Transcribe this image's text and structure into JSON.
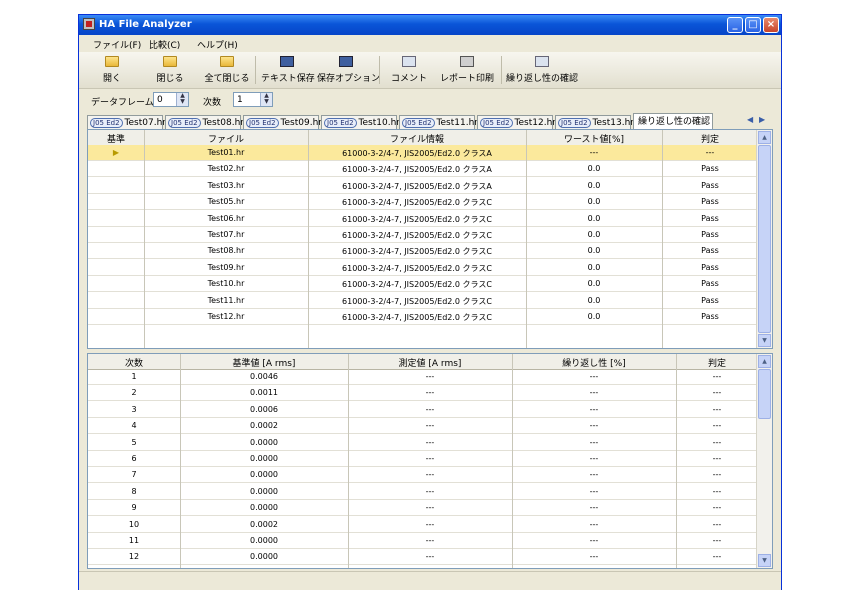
{
  "window": {
    "title": "HA File Analyzer"
  },
  "menu": [
    {
      "label": "ファイル(F)"
    },
    {
      "label": "比較(C)"
    },
    {
      "label": "ヘルプ(H)"
    }
  ],
  "toolbar": [
    {
      "label": "開く",
      "icon": "folder-open-icon"
    },
    {
      "label": "閉じる",
      "icon": "folder-icon"
    },
    {
      "label": "全て閉じる",
      "icon": "folder-icon"
    },
    {
      "label": "テキスト保存",
      "icon": "save-disk-icon"
    },
    {
      "label": "保存オプション",
      "icon": "save-options-icon"
    },
    {
      "label": "コメント",
      "icon": "comment-icon"
    },
    {
      "label": "レポート印刷",
      "icon": "printer-icon"
    },
    {
      "label": "繰り返し性の確認",
      "icon": "repeatability-icon"
    }
  ],
  "frame": {
    "dataframe_label": "データフレーム",
    "dataframe_value": "0",
    "order_label": "次数",
    "order_value": "1"
  },
  "tabs": [
    {
      "badge": "J05 Ed2",
      "name": "Test07.hr"
    },
    {
      "badge": "J05 Ed2",
      "name": "Test08.hr"
    },
    {
      "badge": "J05 Ed2",
      "name": "Test09.hr"
    },
    {
      "badge": "J05 Ed2",
      "name": "Test10.hr"
    },
    {
      "badge": "J05 Ed2",
      "name": "Test11.hr"
    },
    {
      "badge": "J05 Ed2",
      "name": "Test12.hr"
    },
    {
      "badge": "J05 Ed2",
      "name": "Test13.hr"
    },
    {
      "badge": "",
      "name": "繰り返し性の確認"
    }
  ],
  "file_table": {
    "columns": [
      "基準",
      "ファイル",
      "ファイル情報",
      "ワースト値[%]",
      "判定"
    ],
    "rows": [
      [
        "▶",
        "Test01.hr",
        "61000-3-2/4-7, JIS2005/Ed2.0 クラスA",
        "---",
        "---"
      ],
      [
        "",
        "Test02.hr",
        "61000-3-2/4-7, JIS2005/Ed2.0 クラスA",
        "0.0",
        "Pass"
      ],
      [
        "",
        "Test03.hr",
        "61000-3-2/4-7, JIS2005/Ed2.0 クラスA",
        "0.0",
        "Pass"
      ],
      [
        "",
        "Test05.hr",
        "61000-3-2/4-7, JIS2005/Ed2.0 クラスC",
        "0.0",
        "Pass"
      ],
      [
        "",
        "Test06.hr",
        "61000-3-2/4-7, JIS2005/Ed2.0 クラスC",
        "0.0",
        "Pass"
      ],
      [
        "",
        "Test07.hr",
        "61000-3-2/4-7, JIS2005/Ed2.0 クラスC",
        "0.0",
        "Pass"
      ],
      [
        "",
        "Test08.hr",
        "61000-3-2/4-7, JIS2005/Ed2.0 クラスC",
        "0.0",
        "Pass"
      ],
      [
        "",
        "Test09.hr",
        "61000-3-2/4-7, JIS2005/Ed2.0 クラスC",
        "0.0",
        "Pass"
      ],
      [
        "",
        "Test10.hr",
        "61000-3-2/4-7, JIS2005/Ed2.0 クラスC",
        "0.0",
        "Pass"
      ],
      [
        "",
        "Test11.hr",
        "61000-3-2/4-7, JIS2005/Ed2.0 クラスC",
        "0.0",
        "Pass"
      ],
      [
        "",
        "Test12.hr",
        "61000-3-2/4-7, JIS2005/Ed2.0 クラスC",
        "0.0",
        "Pass"
      ]
    ]
  },
  "order_table": {
    "columns": [
      "次数",
      "基準値 [A rms]",
      "測定値 [A rms]",
      "繰り返し性 [%]",
      "判定"
    ],
    "rows": [
      [
        "1",
        "0.0046",
        "---",
        "---",
        "---"
      ],
      [
        "2",
        "0.0011",
        "---",
        "---",
        "---"
      ],
      [
        "3",
        "0.0006",
        "---",
        "---",
        "---"
      ],
      [
        "4",
        "0.0002",
        "---",
        "---",
        "---"
      ],
      [
        "5",
        "0.0000",
        "---",
        "---",
        "---"
      ],
      [
        "6",
        "0.0000",
        "---",
        "---",
        "---"
      ],
      [
        "7",
        "0.0000",
        "---",
        "---",
        "---"
      ],
      [
        "8",
        "0.0000",
        "---",
        "---",
        "---"
      ],
      [
        "9",
        "0.0000",
        "---",
        "---",
        "---"
      ],
      [
        "10",
        "0.0002",
        "---",
        "---",
        "---"
      ],
      [
        "11",
        "0.0000",
        "---",
        "---",
        "---"
      ],
      [
        "12",
        "0.0000",
        "---",
        "---",
        "---"
      ]
    ]
  },
  "colors": {
    "titlebar": "#0a55d8",
    "selected_row": "#fbe99c",
    "chrome": "#ece9d8"
  }
}
